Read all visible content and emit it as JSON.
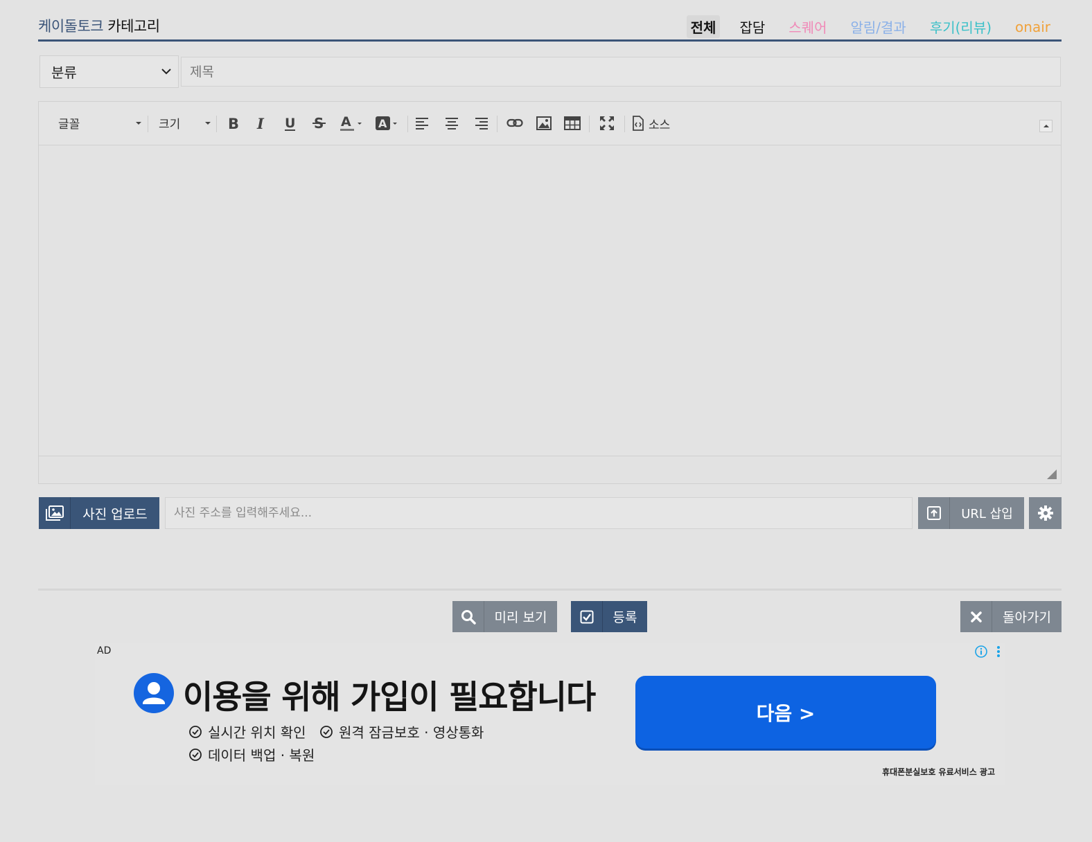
{
  "header": {
    "title_part1": "케이돌토크",
    "title_part2": " 카테고리",
    "categories": [
      {
        "label": "전체",
        "color": "#111111"
      },
      {
        "label": "잡담",
        "color": "#111111"
      },
      {
        "label": "스퀘어",
        "color": "#f08ab8"
      },
      {
        "label": "알림/결과",
        "color": "#8ab0e8"
      },
      {
        "label": "후기(리뷰)",
        "color": "#3cc0c8"
      },
      {
        "label": "onair",
        "color": "#f0a23c"
      }
    ]
  },
  "form": {
    "category_select_value": "분류",
    "title_placeholder": "제목"
  },
  "toolbar": {
    "font_label": "글꼴",
    "size_label": "크기",
    "source_label": "소스"
  },
  "upload": {
    "button_label": "사진 업로드",
    "url_placeholder": "사진 주소를 입력해주세요...",
    "url_insert_label": "URL 삽입"
  },
  "actions": {
    "preview_label": "미리 보기",
    "submit_label": "등록",
    "back_label": "돌아가기"
  },
  "ad": {
    "label": "AD",
    "headline": "이용을 위해 가입이 필요합니다",
    "features": [
      "실시간 위치 확인",
      "원격 잠금보호 · 영상통화",
      "데이터 백업 · 복원"
    ],
    "cta_label": "다음 >",
    "footer": "휴대폰분실보호 유료서비스 광고"
  }
}
